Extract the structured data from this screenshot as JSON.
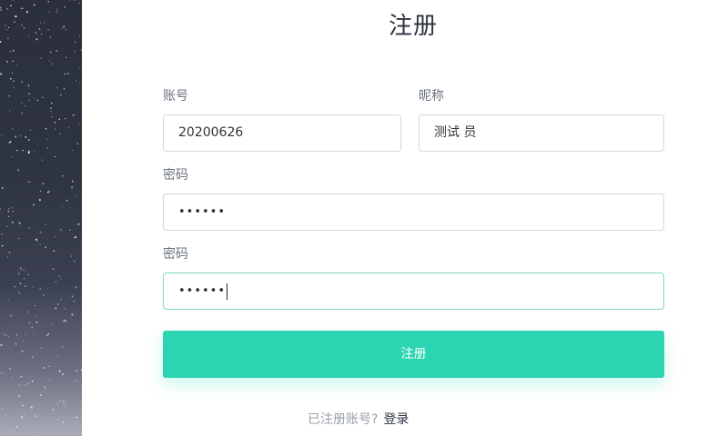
{
  "page_title": "注册",
  "form": {
    "account": {
      "label": "账号",
      "value": "20200626"
    },
    "nickname": {
      "label": "昵称",
      "value": "测试 员"
    },
    "password": {
      "label": "密码",
      "masked_value": "••••••"
    },
    "confirm_password": {
      "label": "密码",
      "masked_value": "••••••"
    },
    "submit_label": "注册"
  },
  "footer": {
    "prompt": "已注册账号?",
    "login_link": "登录"
  },
  "colors": {
    "accent": "#2bd5b1",
    "focus_border": "#7ed9c6",
    "title": "#2c3440"
  }
}
